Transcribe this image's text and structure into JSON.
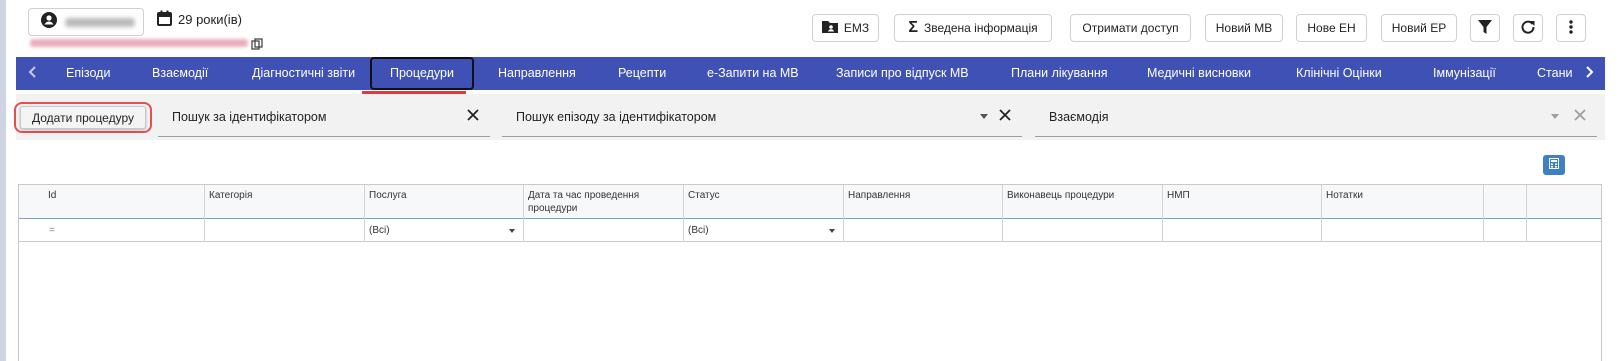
{
  "header": {
    "age": "29 роки(ів)",
    "buttons": {
      "emz": "ЕМЗ",
      "summary": "Зведена інформація",
      "get_access": "Отримати доступ",
      "new_mv": "Новий МВ",
      "new_eh": "Нове ЕН",
      "new_ep": "Новий ЕР"
    }
  },
  "tabs": [
    "Епізоди",
    "Взаємодії",
    "Діагностичні звіти",
    "Процедури",
    "Направлення",
    "Рецепти",
    "е-Запити на МВ",
    "Записи про відпуск МВ",
    "Плани лікування",
    "Медичні висновки",
    "Клінічні Оцінки",
    "Іммунізації",
    "Стани"
  ],
  "active_tab": "Процедури",
  "filters": {
    "add_button": "Додати процедуру",
    "search_id_placeholder": "Пошук за ідентифікатором",
    "search_episode_placeholder": "Пошук епізоду за ідентифікатором",
    "interaction_placeholder": "Взаємодія"
  },
  "grid": {
    "columns": [
      "Id",
      "Категорія",
      "Послуга",
      "Дата та час проведення процедури",
      "Статус",
      "Направлення",
      "Виконавець процедури",
      "НМП",
      "Нотатки"
    ],
    "filter_row": {
      "id_op": "=",
      "service": "(Всі)",
      "status": "(Всі)"
    }
  },
  "colors": {
    "tab_bar": "#3f51b5",
    "highlight": "#e25050"
  }
}
